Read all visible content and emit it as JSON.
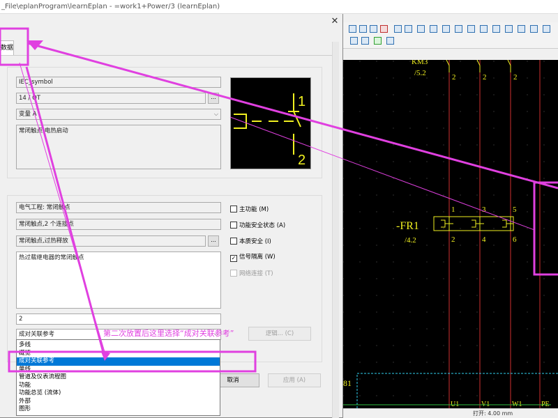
{
  "app_title": "_File\\eplanProgram\\learnEplan - =work1+Power/3 (learnEplan)",
  "dialog": {
    "close_glyph": "✕",
    "tab_label": "数据",
    "symbol_library": "IEC_symbol",
    "symbol_number": "14 / OT",
    "variant": "变量 A",
    "symbol_description": "常闭触点,电热启动",
    "function_category": "电气工程: 常闭触点",
    "function_group": "常闭触点,2 个连接点",
    "function_definition": "常闭触点,过热释放",
    "function_description": "热过载继电器的常闭触点",
    "connection_count": "2",
    "representation_type": "成对关联参考",
    "browse_btn": "...",
    "logic_btn": "逻辑... (C)",
    "cancel_btn": "取消",
    "apply_btn": "应用 (A)",
    "checkboxes": [
      {
        "label": "主功能 (M)",
        "checked": false,
        "disabled": false
      },
      {
        "label": "功能安全状态 (A)",
        "checked": false,
        "disabled": false
      },
      {
        "label": "本质安全 (I)",
        "checked": false,
        "disabled": false
      },
      {
        "label": "信号隔离 (W)",
        "checked": true,
        "disabled": false
      },
      {
        "label": "网络连接 (T)",
        "checked": false,
        "disabled": true
      }
    ],
    "dropdown_items": [
      {
        "label": "多线",
        "selected": false
      },
      {
        "label": "概览",
        "selected": false
      },
      {
        "label": "成对关联参考",
        "selected": true
      },
      {
        "label": "单线",
        "selected": false
      },
      {
        "label": "管道及仪表流程图",
        "selected": false
      },
      {
        "label": "功能",
        "selected": false
      },
      {
        "label": "功能总览 (流体)",
        "selected": false
      },
      {
        "label": "外部",
        "selected": false
      },
      {
        "label": "图形",
        "selected": false
      }
    ],
    "symbol_preview": {
      "pin_top": "1",
      "pin_bottom": "2"
    }
  },
  "annotation": {
    "text": "第二次放置后这里选择“成对关联参考”",
    "color": "#e040e0"
  },
  "schematic": {
    "labels": {
      "km": "KM3",
      "km_ref": "/5.2",
      "fr": "-FR1",
      "fr_ref": "/4.2",
      "km_pins": [
        "2",
        "2",
        "2"
      ],
      "fr_top_pins": [
        "1",
        "3",
        "5"
      ],
      "fr_bottom_pins": [
        "2",
        "4",
        "6"
      ],
      "bottom_terms": [
        "U1",
        "V1",
        "W1",
        "PE"
      ],
      "left_label": "81"
    },
    "colors": {
      "wire": "#d03030",
      "text": "#f0f020",
      "box": "#f0f020"
    }
  },
  "status": {
    "text": "打开: 4.00 mm"
  }
}
